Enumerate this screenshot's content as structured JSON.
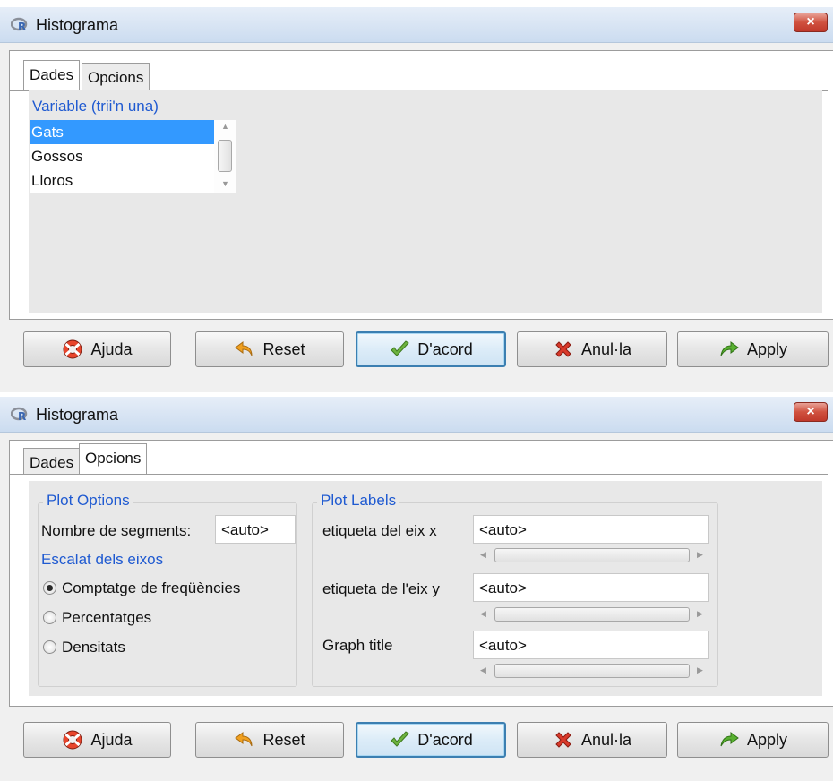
{
  "window1": {
    "title": "Histograma",
    "close_label": "×",
    "tabs": [
      {
        "label": "Dades"
      },
      {
        "label": "Opcions"
      }
    ],
    "variable_label": "Variable (trii'n una)",
    "variables": [
      "Gats",
      "Gossos",
      "Lloros"
    ],
    "selected_variable": "Gats"
  },
  "window2": {
    "title": "Histograma",
    "close_label": "×",
    "tabs": [
      {
        "label": "Dades"
      },
      {
        "label": "Opcions"
      }
    ],
    "plot_options": {
      "legend": "Plot Options",
      "segments_label": "Nombre de segments:",
      "segments_value": "<auto>",
      "axis_scale_label": "Escalat dels eixos",
      "radios": [
        {
          "label": "Comptatge de freqüències",
          "checked": true
        },
        {
          "label": "Percentatges",
          "checked": false
        },
        {
          "label": "Densitats",
          "checked": false
        }
      ]
    },
    "plot_labels": {
      "legend": "Plot Labels",
      "x_label": "etiqueta del eix x",
      "x_value": "<auto>",
      "y_label": "etiqueta de l'eix y",
      "y_value": "<auto>",
      "title_label": "Graph title",
      "title_value": "<auto>"
    }
  },
  "buttons": {
    "help": "Ajuda",
    "reset": "Reset",
    "ok": "D'acord",
    "cancel": "Anul·la",
    "apply": "Apply"
  },
  "colors": {
    "accent_text": "#1f5ad1",
    "selection": "#3399ff",
    "close_button": "#c0392b"
  }
}
